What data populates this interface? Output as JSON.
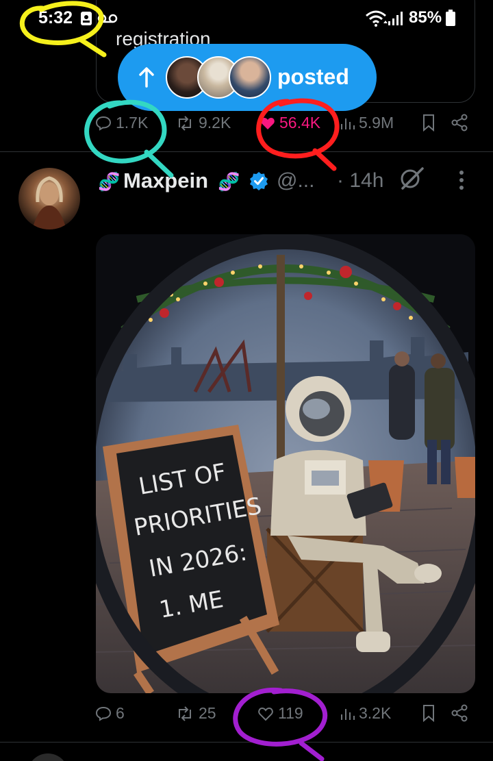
{
  "status_bar": {
    "time": "5:32",
    "battery": "85%",
    "icons": [
      "image-icon",
      "voicemail-icon",
      "wifi-icon",
      "signal-icon",
      "battery-icon"
    ]
  },
  "prev_tweet": {
    "quote_text": "registration",
    "actions": {
      "replies": "1.7K",
      "reposts": "9.2K",
      "likes": "56.4K",
      "views": "5.9M"
    }
  },
  "posted_pill": {
    "label": "posted",
    "avatars": [
      "avatar-1",
      "avatar-2",
      "avatar-3"
    ]
  },
  "tweet": {
    "author_name": "Maxpein",
    "handle": "@...",
    "time": "· 14h",
    "chalkboard_text": [
      "LIST OF",
      "PRIORITIES",
      "IN 2026:",
      "1. ME"
    ],
    "actions": {
      "replies": "6",
      "reposts": "25",
      "likes": "119",
      "views": "3.2K"
    }
  },
  "colors": {
    "background": "#000000",
    "accent_blue": "#1d9bf0",
    "like_pink": "#f91880",
    "muted": "#71767b",
    "annotation_yellow": "#f5f01c",
    "annotation_teal": "#33d7c2",
    "annotation_red": "#ff1e1e",
    "annotation_purple": "#a21fd0"
  }
}
